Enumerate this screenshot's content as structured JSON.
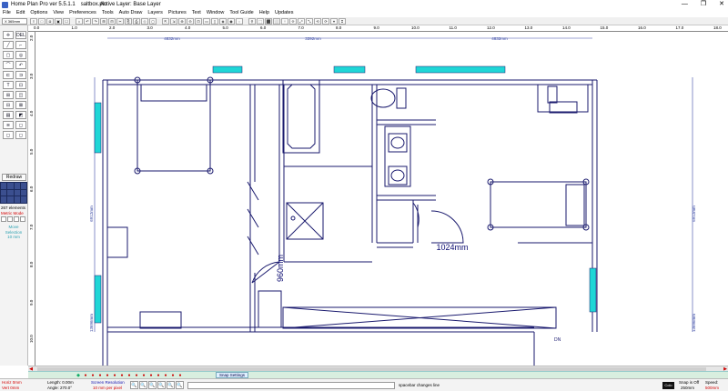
{
  "window": {
    "app_title": "Home Plan Pro ver 5.5.1.1",
    "file_name": "saltbox.pln",
    "active_layer": "Active Layer: Base Layer",
    "controls": [
      "—",
      "❐",
      "✕"
    ]
  },
  "menu": [
    "File",
    "Edit",
    "Options",
    "View",
    "Preferences",
    "Tools",
    "Auto Draw",
    "Layers",
    "Pictures",
    "Text",
    "Window",
    "Tool Guide",
    "Help",
    "Updates"
  ],
  "toolbar": {
    "zoom_display": "X 365mm",
    "buttons": [
      "≡",
      "□",
      "◘",
      "▣",
      "☐",
      "⌂",
      "↶",
      "↷",
      "⊞",
      "⊟",
      "✂",
      "⎘",
      "⎙",
      "◇",
      "◻",
      "⇱",
      "⇲",
      "⊕",
      "⊖",
      "⊡",
      "▭",
      "▯",
      "◈",
      "◉",
      "◌",
      "⚲",
      "⬚",
      "⬛",
      "⬜",
      "⯐",
      "⯑",
      "⤢",
      "⤡",
      "⟲",
      "⟳",
      "⌖",
      "⌗"
    ]
  },
  "palette": {
    "tools": [
      "✛",
      "DEL",
      "╱",
      "⌐",
      "▢",
      "◎",
      "⌒",
      "↶",
      "⊏",
      "⊐",
      "T",
      "⊡",
      "⊞",
      "◫",
      "⊟",
      "⊠",
      "▤",
      "◩",
      "≋",
      "◻",
      "◻",
      "◻"
    ],
    "redraw_label": "Redraw",
    "elements_count": "267 elements",
    "metric_mode": "Metric Mode ∧",
    "move_selection": [
      "Move",
      "Selection",
      "10 mm"
    ]
  },
  "rulers": {
    "horizontal": [
      "0.0",
      "1.0",
      "2.0",
      "3.0",
      "4.0",
      "5.0",
      "6.0",
      "7.0",
      "8.0",
      "9.0",
      "10.0",
      "11.0",
      "12.0",
      "13.0",
      "14.0",
      "15.0",
      "16.0",
      "17.0",
      "18.0"
    ],
    "vertical": [
      "2.0",
      "3.0",
      "4.0",
      "5.0",
      "6.0",
      "7.0",
      "8.0",
      "9.0",
      "10.0",
      "11.0"
    ]
  },
  "plan": {
    "top_dims": [
      "4832mm",
      "3392mm",
      "4832mm"
    ],
    "side_dims": [
      "6912mm",
      "13696mm",
      "6912mm",
      "13696mm"
    ],
    "big_dims": [
      "960mm",
      "1024mm"
    ],
    "stair_label": "DN",
    "colors": {
      "line": "#1a1a6e",
      "window": "#1fd6d6",
      "dim": "#3a48a8"
    }
  },
  "bottom": {
    "snap_settings": "Snap Settings",
    "horiz_label": "Horiz 0mm",
    "vert_label": "Vert 0mm",
    "length_label": "Length: 0.00m",
    "angle_label": "Angle: 270.0°",
    "screen_res_title": "Screen Resolution",
    "screen_res_value": "10 mm per pixel",
    "zoom_buttons": [
      "🔍",
      "🔍",
      "🔍",
      "🔍",
      "🔍",
      "🔍",
      "🔍"
    ],
    "hint": "spacebar changes line",
    "colour_label": "Colo",
    "snap_title": "Snap is Off",
    "snap_value": "250mm",
    "speed_title": "Speed:",
    "speed_value": "500mm"
  }
}
